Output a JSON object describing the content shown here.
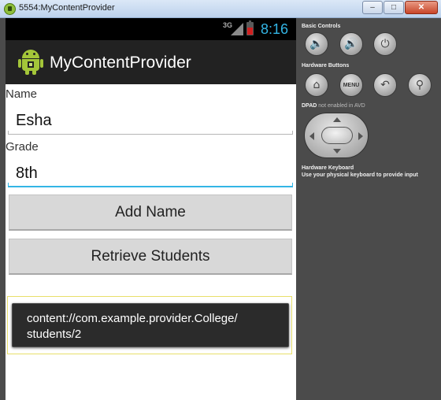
{
  "window": {
    "title": "5554:MyContentProvider",
    "minimize_glyph": "–",
    "maximize_glyph": "□",
    "close_glyph": "✕"
  },
  "status_bar": {
    "network": "3G",
    "time": "8:16"
  },
  "action_bar": {
    "title": "MyContentProvider",
    "icon": "android-icon"
  },
  "form": {
    "name_label": "Name",
    "name_value": "Esha",
    "grade_label": "Grade",
    "grade_value": "8th"
  },
  "buttons": {
    "add_name": "Add Name",
    "retrieve_students": "Retrieve Students"
  },
  "toast": {
    "line1": "content://com.example.provider.College/",
    "line2": "students/2"
  },
  "controls": {
    "basic_controls_label": "Basic Controls",
    "volume_down_glyph": "🔈",
    "volume_up_glyph": "🔊",
    "power_glyph": "⏻",
    "hardware_buttons_label": "Hardware Buttons",
    "home_glyph": "⌂",
    "menu_label": "MENU",
    "back_glyph": "↶",
    "search_glyph": "⚲",
    "dpad_label": "DPAD",
    "dpad_note": "not enabled in AVD",
    "keyboard_label": "Hardware Keyboard",
    "keyboard_note": "Use your physical keyboard to provide input"
  },
  "colors": {
    "accent": "#33b5e5",
    "action_bar": "#222222",
    "toast_bg": "#2b2b2b",
    "android_green": "#a4c639",
    "battery_alert": "#d02020"
  }
}
